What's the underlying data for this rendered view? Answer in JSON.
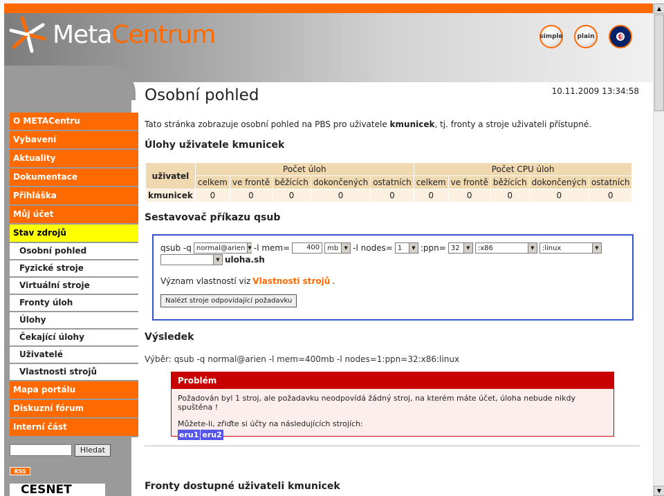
{
  "header": {
    "logo_meta": "Meta",
    "logo_centrum": "Centrum",
    "btn_simple": "simple",
    "btn_plain": "plain",
    "btn_lang": "EN"
  },
  "sidebar": {
    "items": [
      {
        "label": "O METACentru"
      },
      {
        "label": "Vybavení"
      },
      {
        "label": "Aktuality"
      },
      {
        "label": "Dokumentace"
      },
      {
        "label": "Přihláška"
      },
      {
        "label": "Můj účet"
      },
      {
        "label": "Stav zdrojů"
      }
    ],
    "subitems": [
      {
        "label": "Osobní pohled"
      },
      {
        "label": "Fyzické stroje"
      },
      {
        "label": "Virtuální stroje"
      },
      {
        "label": "Fronty úloh"
      },
      {
        "label": "Úlohy"
      },
      {
        "label": "Čekající úlohy"
      },
      {
        "label": "Uživatelé"
      },
      {
        "label": "Vlastnosti strojů"
      }
    ],
    "bottom_items": [
      {
        "label": "Mapa portálu"
      },
      {
        "label": "Diskuzní fórum"
      },
      {
        "label": "Interní část"
      }
    ],
    "search_button": "Hledat",
    "rss": "RSS",
    "cesnet": "CESNET"
  },
  "main": {
    "title": "Osobní pohled",
    "timestamp": "10.11.2009 13:34:58",
    "intro_pre": "Tato stránka zobrazuje osobní pohled na PBS pro uživatele ",
    "intro_user": "kmunicek",
    "intro_post": ", tj. fronty a stroje uživateli přístupné.",
    "jobs_heading": "Úlohy uživatele kmunicek",
    "table": {
      "col_user": "uživatel",
      "group1": "Počet úloh",
      "group2": "Počet CPU úloh",
      "sub": [
        "celkem",
        "ve frontě",
        "běžících",
        "dokončených",
        "ostatních"
      ],
      "row_user": "kmunicek",
      "values": [
        "0",
        "0",
        "0",
        "0",
        "0",
        "0",
        "0",
        "0",
        "0",
        "0"
      ]
    },
    "qsub_heading": "Sestavovač příkazu qsub",
    "qsub": {
      "prefix": "qsub -q",
      "queue": "normal@arien",
      "mem_label": "-l mem=",
      "mem_value": "400",
      "mem_unit": "mb",
      "nodes_label": "-l nodes=",
      "nodes_value": "1",
      "ppn_label": ":ppn=",
      "ppn_value": "32",
      "arch": ":x86",
      "os": ":linux",
      "extra": "",
      "script": "uloha.sh",
      "props_pre": "Význam vlastností viz ",
      "props_link": "Vlastnosti strojů",
      "props_post": ".",
      "find_button": "Nalézt stroje odpovídající požadavku"
    },
    "result_heading": "Výsledek",
    "result_selection": "Výběr: qsub -q normal@arien -l mem=400mb -l nodes=1:ppn=32:x86:linux",
    "problem": {
      "title": "Problém",
      "message": "Požadován byl 1 stroj, ale požadavku neodpovídá žádný stroj, na kterém máte účet, úloha nebude nikdy spuštěna !",
      "hint": "Můžete-li, zřiďte si účty na následujících strojích:",
      "machines": [
        "eru1",
        "eru2"
      ]
    },
    "queues_heading": "Fronty dostupné uživateli kmunicek"
  },
  "colors": {
    "accent": "#ff6a00",
    "active_nav": "#ffff00",
    "error": "#c80000",
    "box_border": "#3355cc",
    "machine": "#5555ee"
  }
}
